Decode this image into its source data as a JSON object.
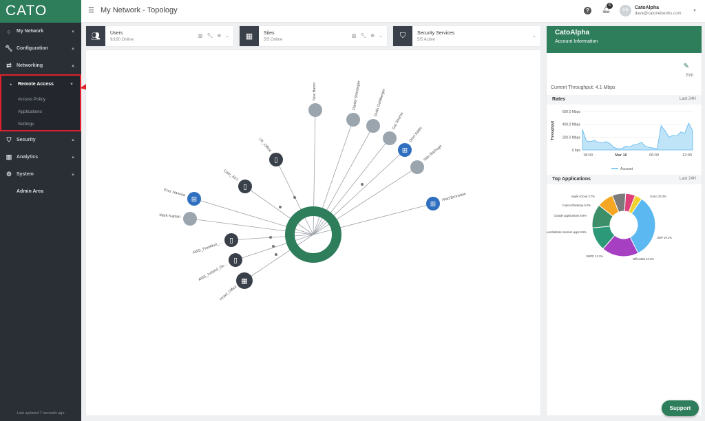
{
  "brand": "CATO",
  "header": {
    "title": "My Network - Topology",
    "notifications_count": "6",
    "avatar_initials": "DB",
    "account_name": "CatoAlpha",
    "account_email": "dave@catonetworks.com"
  },
  "sidebar": {
    "items": [
      {
        "label": "My Network",
        "icon": "circle-icon"
      },
      {
        "label": "Configuration",
        "icon": "wrench-icon"
      },
      {
        "label": "Networking",
        "icon": "network-icon"
      },
      {
        "label": "Remote Access",
        "icon": "remote-icon"
      },
      {
        "label": "Security",
        "icon": "shield-icon"
      },
      {
        "label": "Analytics",
        "icon": "bar-chart-icon"
      },
      {
        "label": "System",
        "icon": "gear-icon"
      }
    ],
    "remote_access_sub": [
      "Access Policy",
      "Applications",
      "Settings"
    ],
    "admin_area": "Admin Area",
    "last_updated": "Last updated 7 seconds ago"
  },
  "cards": [
    {
      "title": "Users",
      "subtitle": "9/160 Online"
    },
    {
      "title": "Sites",
      "subtitle": "5/5 Online"
    },
    {
      "title": "Security Services",
      "subtitle": "5/5 Active"
    }
  ],
  "topology": {
    "nodes": [
      {
        "label": "Noa Baron",
        "kind": "apple-icon"
      },
      {
        "label": "Daniel Shlesinger",
        "kind": "apple-icon"
      },
      {
        "label": "Dudu Goldberger",
        "kind": "apple-icon"
      },
      {
        "label": "Gal Shema",
        "kind": "apple-icon"
      },
      {
        "label": "Omri Addix",
        "kind": "windows-icon"
      },
      {
        "label": "Idan Barbugo",
        "kind": "apple-icon"
      },
      {
        "label": "Atad Bronstein",
        "kind": "windows-icon"
      },
      {
        "label": "UK_Office",
        "kind": "site-icon"
      },
      {
        "label": "Cato_AFJ",
        "kind": "site-icon"
      },
      {
        "label": "Erez Hanuka",
        "kind": "windows-icon"
      },
      {
        "label": "Mark Kaplan",
        "kind": "apple-icon"
      },
      {
        "label": "AWS_Frankfurt_...",
        "kind": "site-icon"
      },
      {
        "label": "AWS_Ireland_De...",
        "kind": "site-icon"
      },
      {
        "label": "Israel_Office",
        "kind": "building-icon"
      }
    ]
  },
  "account_panel": {
    "title": "CatoAlpha",
    "subtitle": "Account Information",
    "edit_label": "Edit",
    "throughput": "Current Throughput: 4.1 Mbps",
    "rates_title": "Rates",
    "rates_range": "Last 24H",
    "top_apps_title": "Top Applications",
    "top_apps_range": "Last 24H"
  },
  "chart_data": [
    {
      "type": "area",
      "ylabel": "Throughput",
      "ylim": [
        0,
        600
      ],
      "y_ticks": [
        "600.0 Mbps",
        "400.0 Mbps",
        "200.0 Mbps",
        "0 bps"
      ],
      "x_ticks": [
        "18:00",
        "Mar 16",
        "06:00",
        "12:00"
      ],
      "series": [
        {
          "name": "Account",
          "values": [
            320,
            140,
            130,
            150,
            120,
            110,
            130,
            100,
            40,
            20,
            20,
            60,
            50,
            80,
            90,
            120,
            60,
            40,
            30,
            20,
            380,
            300,
            200,
            230,
            220,
            280,
            260,
            420,
            300
          ]
        }
      ]
    },
    {
      "type": "pie",
      "labels": [
        "Zoom 33.3%",
        "UDP 19.1%",
        "Office365 12.3%",
        "SMPP 12.3%",
        "Search&Misc internet apps 8.5%",
        "Google applications 6.9%",
        "Codecs/Desktop 5.0%",
        "Apple iCloud 3.7%"
      ],
      "values": [
        33.3,
        19.1,
        12.3,
        12.3,
        8.5,
        6.9,
        5.0,
        3.7
      ],
      "colors": [
        "#5bb8f0",
        "#a63fc2",
        "#2c9a78",
        "#3d8f6a",
        "#f5a623",
        "#7b7b7b",
        "#e0407a",
        "#f2d22e"
      ]
    }
  ]
}
